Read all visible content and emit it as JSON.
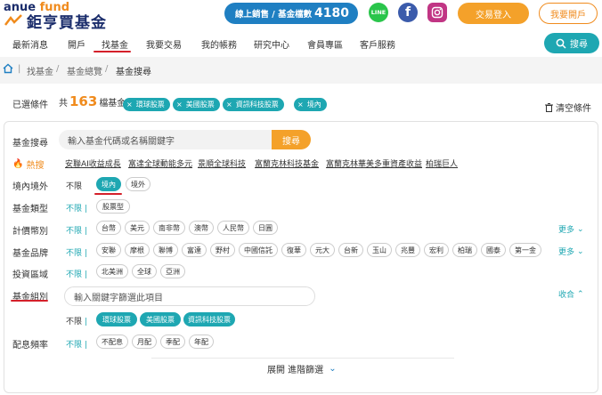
{
  "brand": {
    "top_prefix": "anue",
    "top_suffix": "fund",
    "name": "鉅亨買基金"
  },
  "counter": {
    "label": "線上銷售 / 基金檔數",
    "value": "4180"
  },
  "social": {
    "line": "LINE",
    "facebook": "f",
    "instagram": "IG"
  },
  "header_buttons": {
    "login": "交易登入",
    "open_account": "我要開戶"
  },
  "nav": {
    "items": [
      "最新消息",
      "開戶",
      "找基金",
      "我要交易",
      "我的帳務",
      "研究中心",
      "會員專區",
      "客戶服務"
    ],
    "search_label": "搜尋"
  },
  "breadcrumb": {
    "items": [
      "找基金",
      "基金總覽",
      "基金搜尋"
    ]
  },
  "conditions": {
    "label": "已選條件",
    "count_prefix": "共",
    "count": "163",
    "count_suffix": "檔基金",
    "tags": [
      "環球股票",
      "美國股票",
      "資訊科技股票",
      "境內"
    ],
    "clear_label": "清空條件"
  },
  "search": {
    "label": "基金搜尋",
    "placeholder": "輸入基金代碼或名稱關鍵字",
    "button": "搜尋"
  },
  "hot": {
    "label": "熱搜",
    "links": [
      "安聯AI收益成長",
      "富達全球動能多元",
      "景順全球科技",
      "富蘭克林科技基金",
      "富蘭克林華美多重資產收益",
      "柏瑞巨人"
    ]
  },
  "filters": {
    "region": {
      "label": "境內境外",
      "unlimited": "不限",
      "options": [
        "境內",
        "境外"
      ]
    },
    "type": {
      "label": "基金類型",
      "unlimited": "不限",
      "options": [
        "股票型"
      ]
    },
    "currency": {
      "label": "計價幣別",
      "unlimited": "不限",
      "options": [
        "台幣",
        "美元",
        "南非幣",
        "澳幣",
        "人民幣",
        "日圓"
      ],
      "more": "更多"
    },
    "brand": {
      "label": "基金品牌",
      "unlimited": "不限",
      "options": [
        "安聯",
        "摩根",
        "聯博",
        "富達",
        "野村",
        "中國信託",
        "復華",
        "元大",
        "台新",
        "玉山",
        "兆豐",
        "宏利",
        "柏瑞",
        "國泰",
        "第一金"
      ],
      "more": "更多"
    },
    "area": {
      "label": "投資區域",
      "unlimited": "不限",
      "options": [
        "北美洲",
        "全球",
        "亞洲"
      ]
    },
    "group": {
      "label": "基金組別",
      "keyword_placeholder": "輸入關鍵字篩選此項目",
      "collapse": "收合",
      "unlimited": "不限",
      "options": [
        "環球股票",
        "美國股票",
        "資訊科技股票"
      ]
    },
    "dividend": {
      "label": "配息頻率",
      "unlimited": "不限",
      "options": [
        "不配息",
        "月配",
        "季配",
        "年配"
      ]
    }
  },
  "expand_label": "展開 進階篩選",
  "colors": {
    "teal": "#1ea7b2",
    "orange": "#f4a12a",
    "navy": "#1a2c6b",
    "red": "#d4202a"
  }
}
